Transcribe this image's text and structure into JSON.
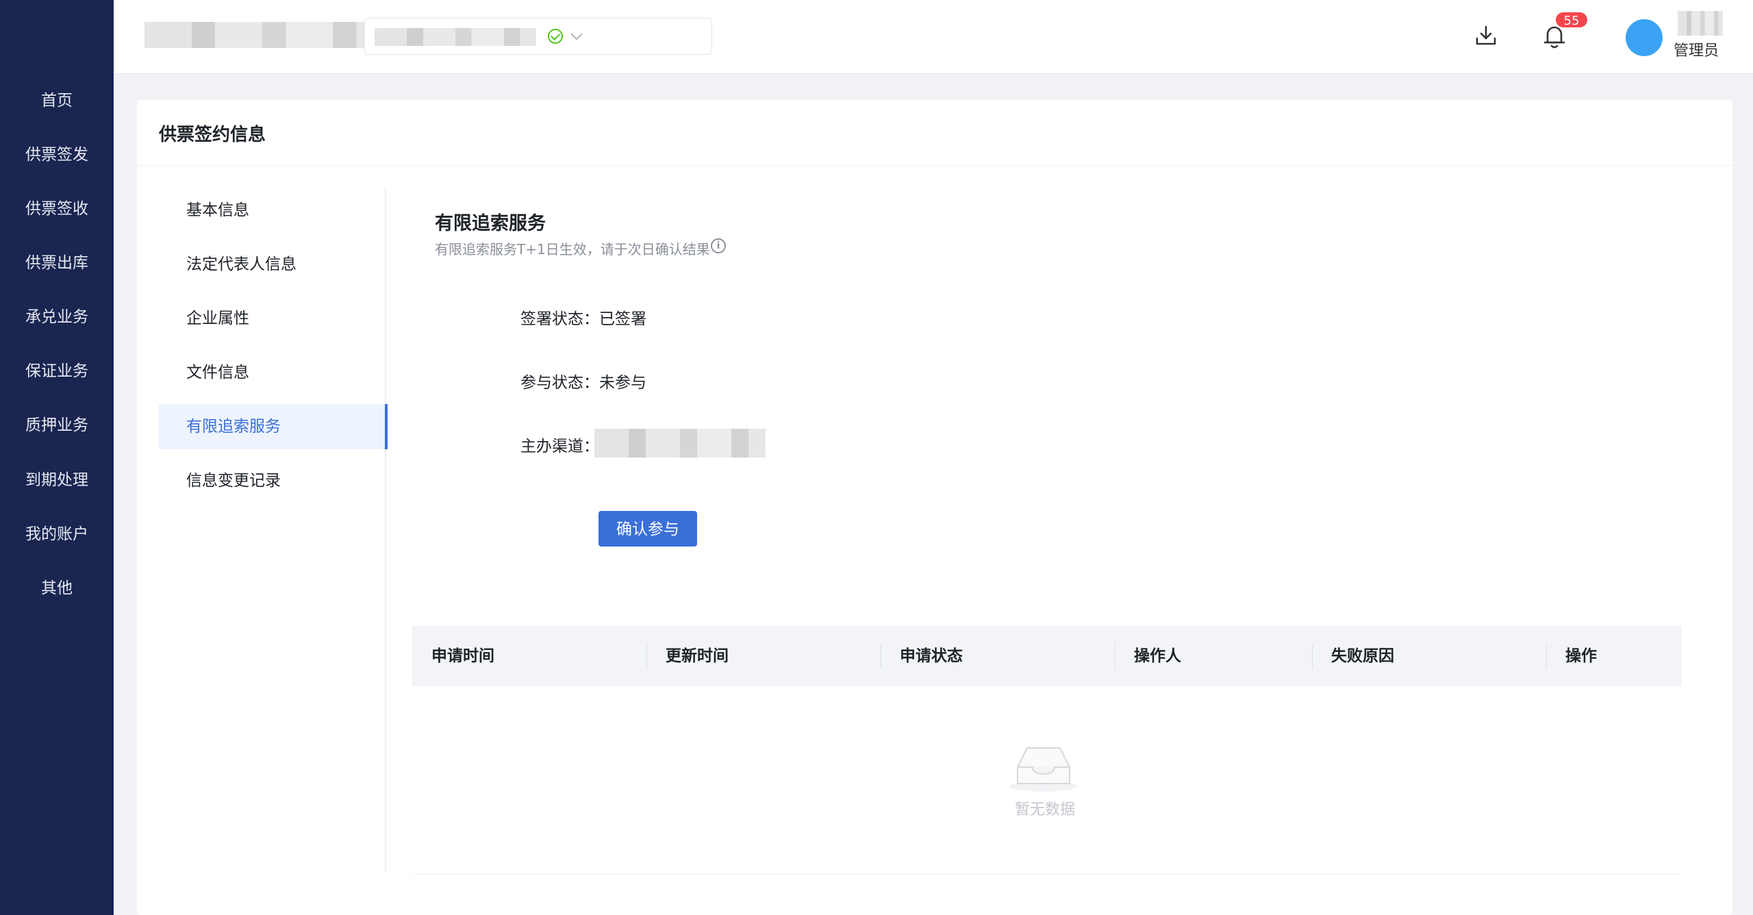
{
  "sidebar": {
    "items": [
      {
        "label": "首页"
      },
      {
        "label": "供票签发"
      },
      {
        "label": "供票签收"
      },
      {
        "label": "供票出库"
      },
      {
        "label": "承兑业务"
      },
      {
        "label": "保证业务"
      },
      {
        "label": "质押业务"
      },
      {
        "label": "到期处理"
      },
      {
        "label": "我的账户"
      },
      {
        "label": "其他"
      }
    ]
  },
  "header": {
    "notification_count": "55",
    "user_role": "管理员",
    "icons": [
      "download-icon",
      "bell-icon",
      "check-circle-icon",
      "chevron-down-icon"
    ]
  },
  "page": {
    "title": "供票签约信息"
  },
  "tabs": [
    {
      "label": "基本信息"
    },
    {
      "label": "法定代表人信息"
    },
    {
      "label": "企业属性"
    },
    {
      "label": "文件信息"
    },
    {
      "label": "有限追索服务",
      "active": true
    },
    {
      "label": "信息变更记录"
    }
  ],
  "section": {
    "title": "有限追索服务",
    "subtitle": "有限追索服务T+1日生效，请于次日确认结果",
    "fields": [
      {
        "label": "签署状态：",
        "value": "已签署"
      },
      {
        "label": "参与状态：",
        "value": "未参与"
      },
      {
        "label": "主办渠道：",
        "value": ""
      }
    ],
    "confirm_button": "确认参与"
  },
  "table": {
    "columns": [
      "申请时间",
      "更新时间",
      "申请状态",
      "操作人",
      "失败原因",
      "操作"
    ],
    "rows": [],
    "empty_text": "暂无数据"
  },
  "colors": {
    "sidebar_bg": "#1a2550",
    "primary": "#3a6fd8",
    "badge": "#f5454c",
    "success": "#52c41a"
  }
}
